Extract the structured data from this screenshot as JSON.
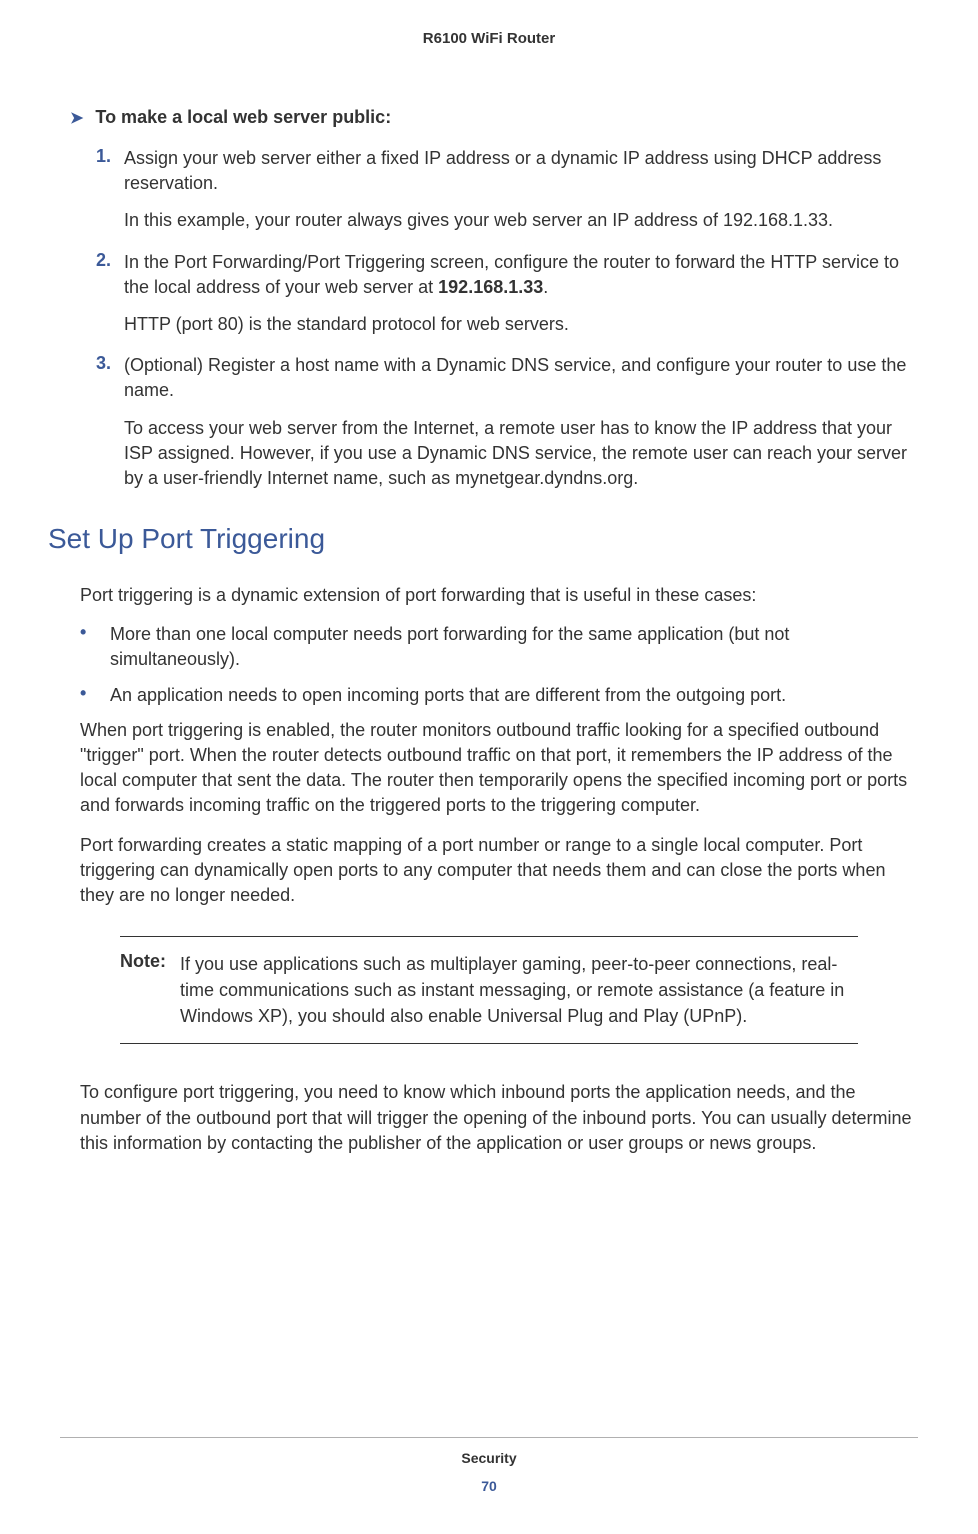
{
  "header": {
    "title": "R6100 WiFi Router"
  },
  "procedure": {
    "heading": "To make a local web server public:",
    "steps": [
      {
        "num": "1.",
        "text": "Assign your web server either a fixed IP address or a dynamic IP address using DHCP address reservation.",
        "sub": "In this example, your router always gives your web server an IP address of 192.168.1.33."
      },
      {
        "num": "2.",
        "textPre": "In the Port Forwarding/Port Triggering screen, configure the router to forward the HTTP service to the local address of your web server at ",
        "textBold": "192.168.1.33",
        "textPost": ".",
        "sub": "HTTP (port 80) is the standard protocol for web servers."
      },
      {
        "num": "3.",
        "text": "(Optional) Register a host name with a Dynamic DNS service, and configure your router to use the name.",
        "sub": "To access your web server from the Internet, a remote user has to know the IP address that your ISP assigned. However, if you use a Dynamic DNS service, the remote user can reach your server by a user-friendly Internet name, such as mynetgear.dyndns.org."
      }
    ]
  },
  "section": {
    "heading": "Set Up Port Triggering",
    "intro": "Port triggering is a dynamic extension of port forwarding that is useful in these cases:",
    "bullets": [
      "More than one local computer needs port forwarding for the same application (but not simultaneously).",
      "An application needs to open incoming ports that are different from the outgoing port."
    ],
    "para1": "When port triggering is enabled, the router monitors outbound traffic looking for a specified outbound \"trigger\" port. When the router detects outbound traffic on that port, it remembers the IP address of the local computer that sent the data. The router then temporarily opens the specified incoming port or ports and forwards incoming traffic on the triggered ports to the triggering computer.",
    "para2": "Port forwarding creates a static mapping of a port number or range to a single local computer. Port triggering can dynamically open ports to any computer that needs them and can close the ports when they are no longer needed.",
    "note": {
      "label": "Note:",
      "text": "If you use applications such as multiplayer gaming, peer-to-peer connections, real-time communications such as instant messaging, or remote assistance (a feature in Windows XP), you should also enable Universal Plug and Play (UPnP)."
    },
    "para3": "To configure port triggering, you need to know which inbound ports the application needs, and the number of the outbound port that will trigger the opening of the inbound ports. You can usually determine this information by contacting the publisher of the application or user groups or news groups."
  },
  "footer": {
    "chapter": "Security",
    "page": "70"
  }
}
